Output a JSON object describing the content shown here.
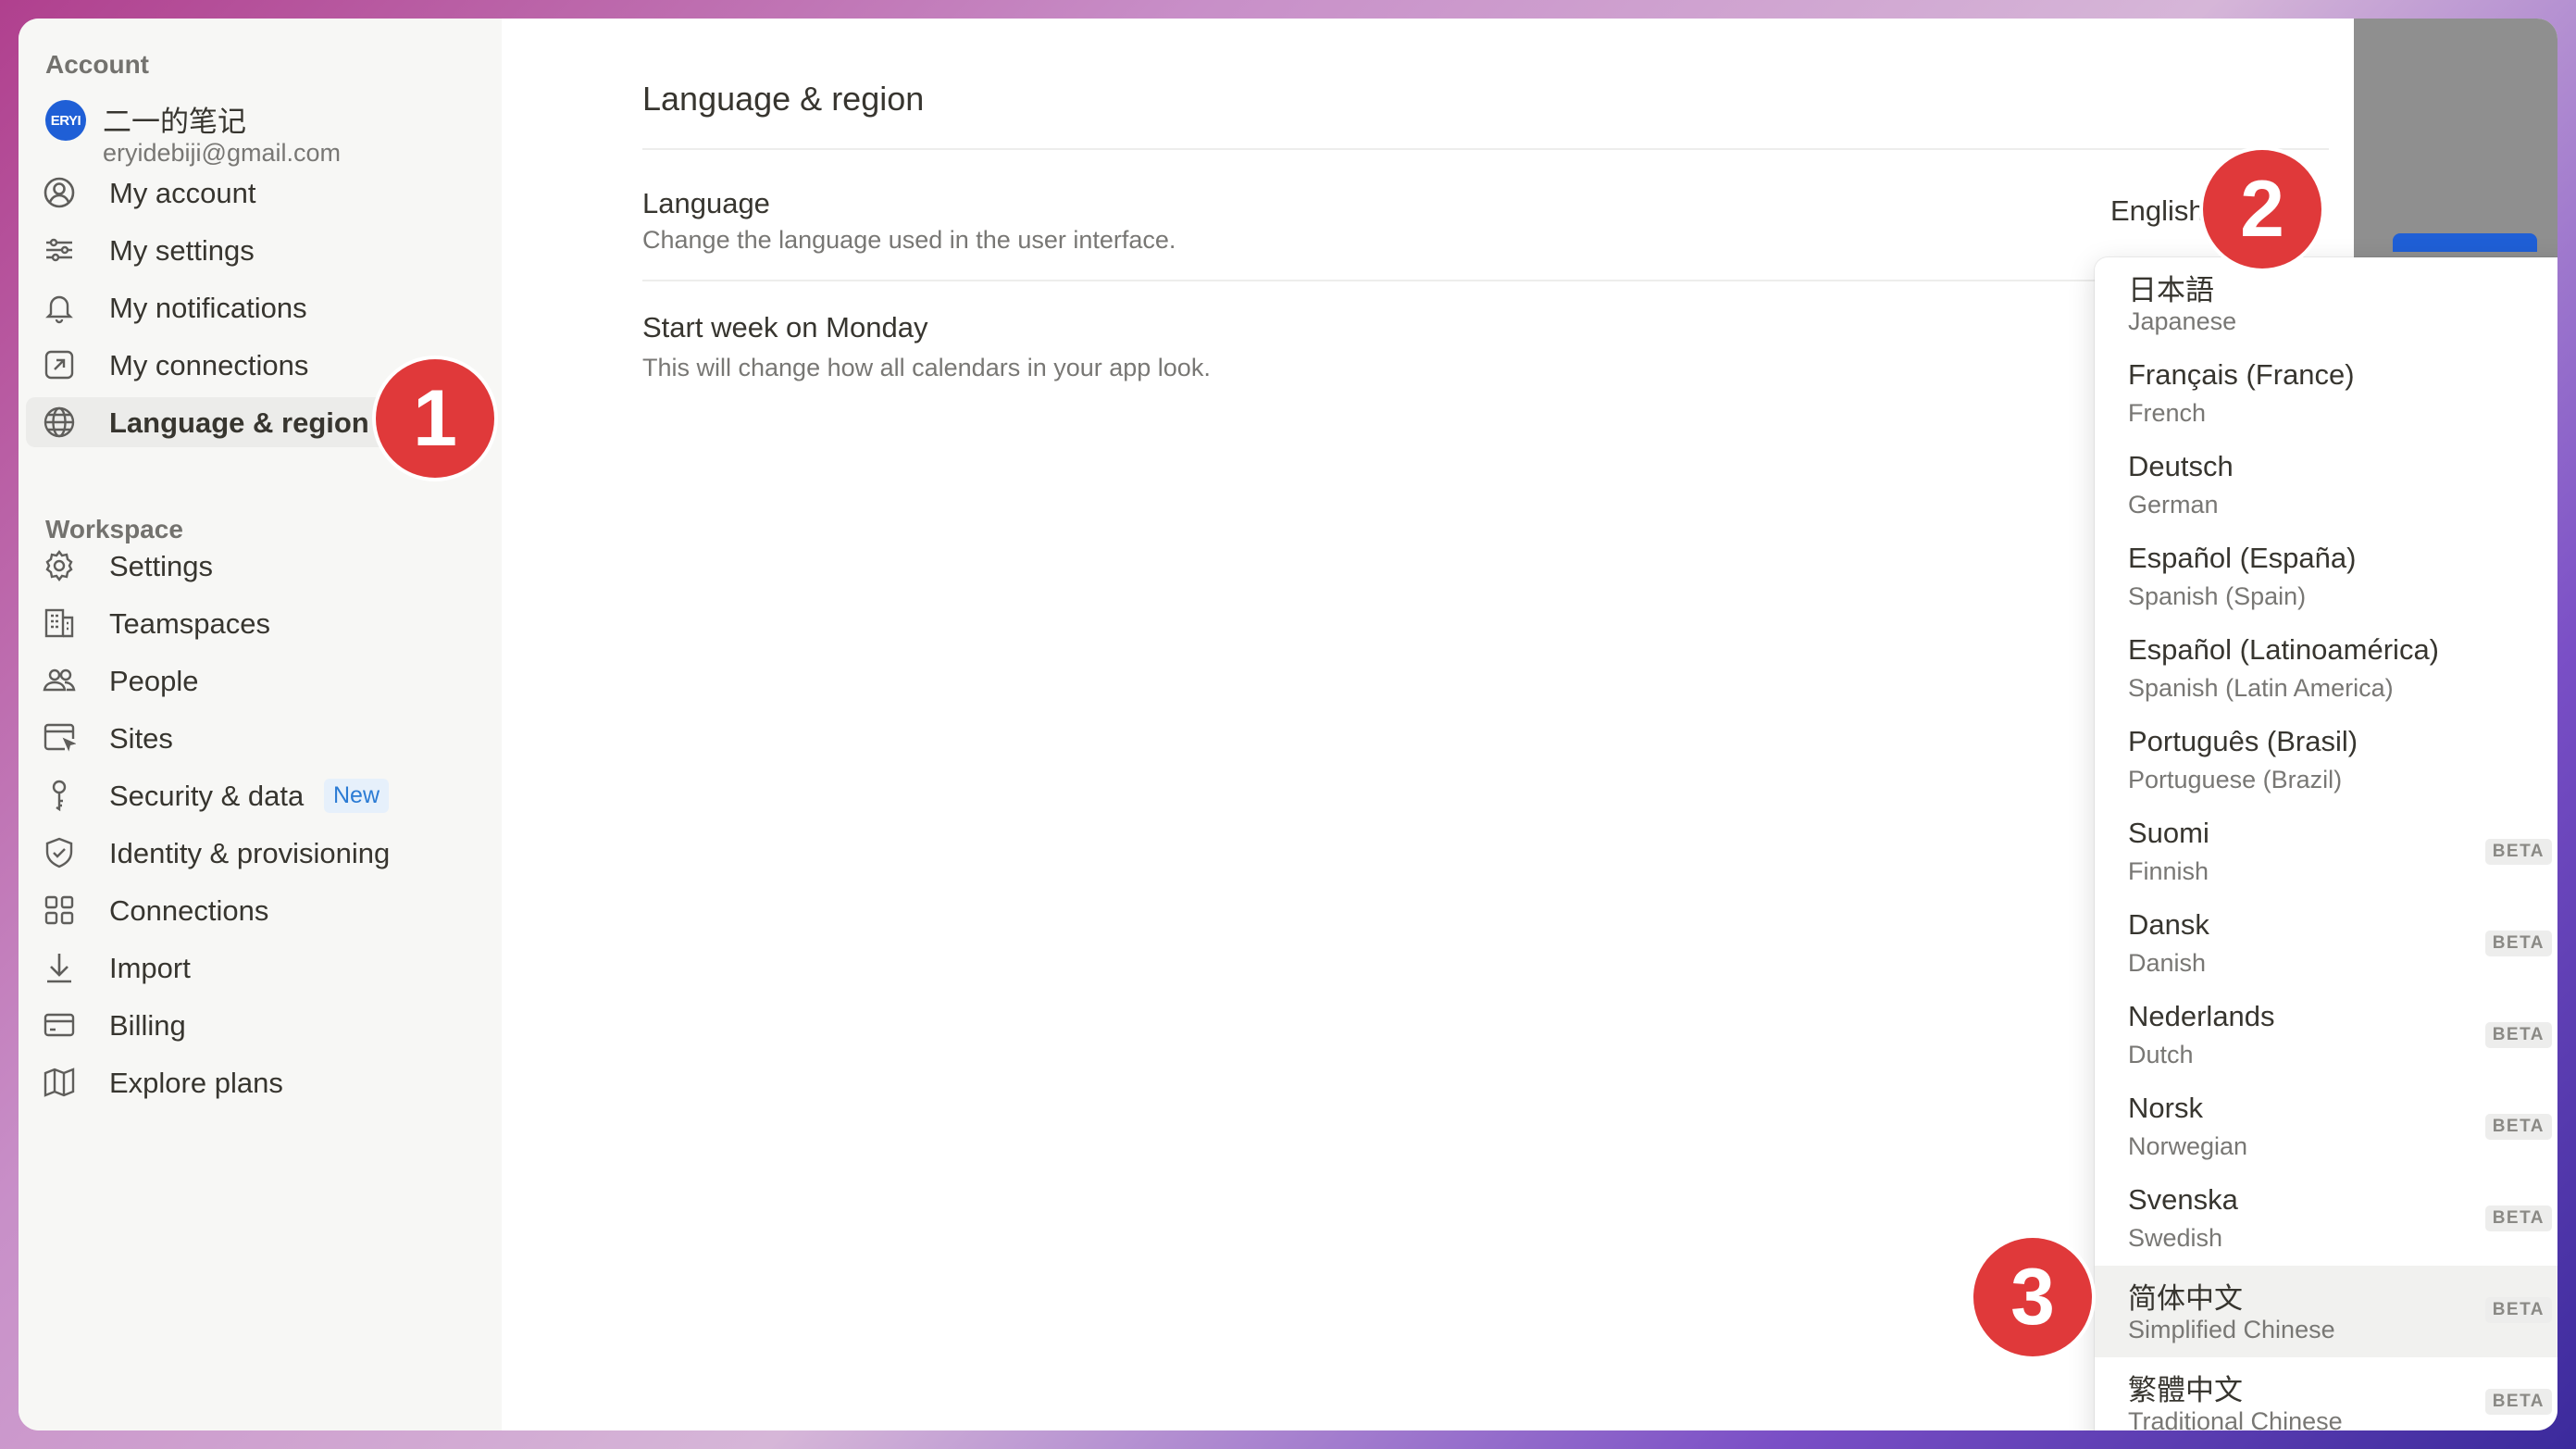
{
  "sidebar": {
    "account_title": "Account",
    "profile": {
      "avatar_text": "ERYI",
      "name": "二一的笔记",
      "email": "eryidebiji@gmail.com"
    },
    "account_items": [
      {
        "label": "My account",
        "icon": "user-circle-icon"
      },
      {
        "label": "My settings",
        "icon": "sliders-icon"
      },
      {
        "label": "My notifications",
        "icon": "bell-icon"
      },
      {
        "label": "My connections",
        "icon": "external-link-box-icon"
      },
      {
        "label": "Language & region",
        "icon": "globe-icon",
        "active": true
      }
    ],
    "workspace_title": "Workspace",
    "workspace_items": [
      {
        "label": "Settings",
        "icon": "gear-icon"
      },
      {
        "label": "Teamspaces",
        "icon": "building-icon"
      },
      {
        "label": "People",
        "icon": "people-icon"
      },
      {
        "label": "Sites",
        "icon": "browser-cursor-icon"
      },
      {
        "label": "Security & data",
        "icon": "key-icon",
        "badge": "New"
      },
      {
        "label": "Identity & provisioning",
        "icon": "shield-check-icon"
      },
      {
        "label": "Connections",
        "icon": "grid-apps-icon"
      },
      {
        "label": "Import",
        "icon": "download-arrow-icon"
      },
      {
        "label": "Billing",
        "icon": "credit-card-icon"
      },
      {
        "label": "Explore plans",
        "icon": "map-icon"
      }
    ]
  },
  "main": {
    "title": "Language & region",
    "language": {
      "title": "Language",
      "description": "Change the language used in the user interface.",
      "value": "English"
    },
    "week": {
      "title": "Start week on Monday",
      "description": "This will change how all calendars in your app look."
    }
  },
  "dropdown": {
    "beta_label": "BETA",
    "options": [
      {
        "native": "日本語",
        "english": "Japanese",
        "beta": false
      },
      {
        "native": "Français (France)",
        "english": "French",
        "beta": false
      },
      {
        "native": "Deutsch",
        "english": "German",
        "beta": false
      },
      {
        "native": "Español (España)",
        "english": "Spanish (Spain)",
        "beta": false
      },
      {
        "native": "Español (Latinoamérica)",
        "english": "Spanish (Latin America)",
        "beta": false
      },
      {
        "native": "Português (Brasil)",
        "english": "Portuguese (Brazil)",
        "beta": false
      },
      {
        "native": "Suomi",
        "english": "Finnish",
        "beta": true
      },
      {
        "native": "Dansk",
        "english": "Danish",
        "beta": true
      },
      {
        "native": "Nederlands",
        "english": "Dutch",
        "beta": true
      },
      {
        "native": "Norsk",
        "english": "Norwegian",
        "beta": true
      },
      {
        "native": "Svenska",
        "english": "Swedish",
        "beta": true
      },
      {
        "native": "简体中文",
        "english": "Simplified Chinese",
        "beta": true,
        "hover": true
      },
      {
        "native": "繁體中文",
        "english": "Traditional Chinese",
        "beta": true
      }
    ]
  },
  "callouts": [
    "1",
    "2",
    "3"
  ],
  "colors": {
    "callout": "#e0393a",
    "accent": "#1f5fd6",
    "badge_new_text": "#2b7bd4"
  }
}
